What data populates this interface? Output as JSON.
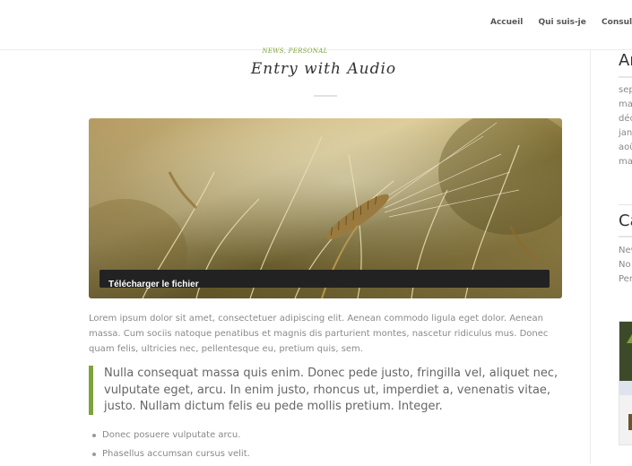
{
  "nav": {
    "items": [
      "Accueil",
      "Qui suis-je",
      "Consultation"
    ]
  },
  "post": {
    "meta": "NEWS, PERSONAL",
    "title": "Entry with Audio",
    "audio_download_label": "Télécharger le fichier",
    "paragraph": "Lorem ipsum dolor sit amet, consectetuer adipiscing elit. Aenean commodo ligula eget dolor. Aenean massa. Cum sociis natoque penatibus et magnis dis parturient montes, nascetur ridiculus mus. Donec quam felis, ultricies nec, pellentesque eu, pretium quis, sem.",
    "quote": "Nulla consequat massa quis enim. Donec pede justo, fringilla vel, aliquet nec, vulputate eget, arcu. In enim justo, rhoncus ut, imperdiet a, venenatis vitae, justo. Nullam dictum felis eu pede mollis pretium. Integer.",
    "list": [
      "Donec posuere vulputate arcu.",
      "Phasellus accumsan cursus velit."
    ]
  },
  "sidebar": {
    "archives": {
      "title": "Ar",
      "items": [
        "sep",
        "ma",
        "déc",
        "jan",
        "aoû",
        "ma"
      ]
    },
    "categories": {
      "title": "Ca",
      "items": [
        "New",
        "No",
        "Per"
      ]
    }
  },
  "colors": {
    "accent": "#7da33b",
    "audio_bar": "#222222"
  }
}
